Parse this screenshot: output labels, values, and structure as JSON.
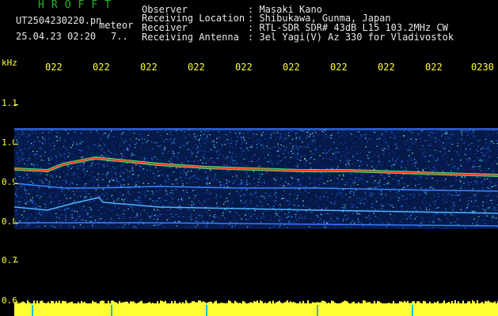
{
  "header": {
    "brand": "HROFFT",
    "filename": "UT2504230220.pn",
    "tag": "meteor",
    "datetime": "25.04.23 02:20",
    "counter": "7.."
  },
  "info": {
    "observer_label": "Observer",
    "observer": ": Masaki Kano",
    "location_label": "Receiving Location",
    "location": ": Shibukawa, Gunma, Japan",
    "receiver_label": "Receiver",
    "receiver": ": RTL-SDR SDR# 43dB L15 103.2MHz CW",
    "antenna_label": "Receiving Antenna",
    "antenna": ": 3el Yagi(V) Az 330 for Vladivostok"
  },
  "axis": {
    "unit": "kHz",
    "time_ticks": [
      "022",
      "022",
      "022",
      "022",
      "022",
      "022",
      "022",
      "022",
      "022",
      "0230"
    ],
    "freq_ticks": [
      "1.1",
      "1.0",
      "0.9",
      "0.8",
      "0.7",
      "0.6"
    ]
  },
  "colors": {
    "background": "#000000",
    "text": "#e8e8e8",
    "brand": "#1fb81f",
    "ticks": "#ffff33",
    "signal": "#ff3b1f"
  }
}
